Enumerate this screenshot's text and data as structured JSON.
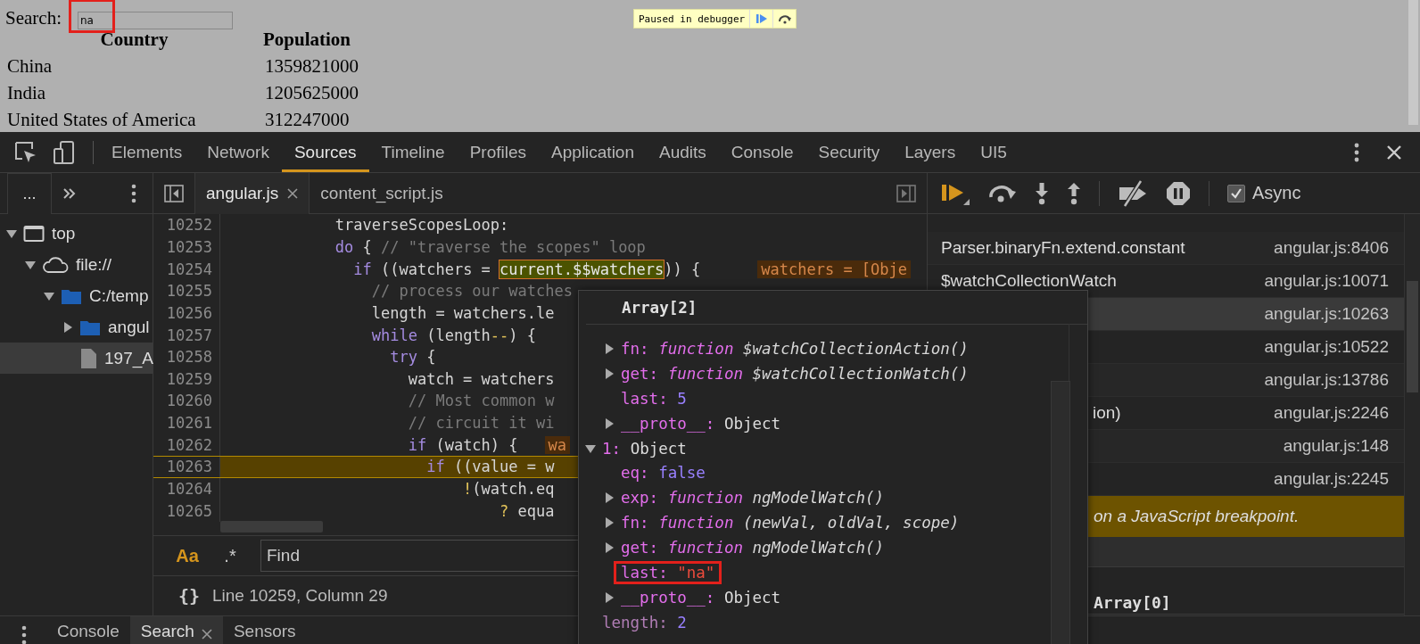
{
  "page": {
    "search_label": "Search:",
    "search_value": "na",
    "search_annotated": true,
    "table": {
      "columns": [
        "Country",
        "Population"
      ],
      "rows": [
        [
          "China",
          "1359821000"
        ],
        [
          "India",
          "1205625000"
        ],
        [
          "United States of America",
          "312247000"
        ]
      ]
    },
    "paused_text": "Paused in debugger"
  },
  "devtools": {
    "tabs": [
      {
        "label": "Elements",
        "selected": false
      },
      {
        "label": "Network",
        "selected": false
      },
      {
        "label": "Sources",
        "selected": true
      },
      {
        "label": "Timeline",
        "selected": false
      },
      {
        "label": "Profiles",
        "selected": false
      },
      {
        "label": "Application",
        "selected": false
      },
      {
        "label": "Audits",
        "selected": false
      },
      {
        "label": "Console",
        "selected": false
      },
      {
        "label": "Security",
        "selected": false
      },
      {
        "label": "Layers",
        "selected": false
      },
      {
        "label": "UI5",
        "selected": false
      }
    ],
    "navigator": {
      "tab_label": "...",
      "tree": [
        {
          "label": "top",
          "kind": "frame",
          "expanded": true,
          "selected": false,
          "children": [
            {
              "label": "file://",
              "kind": "origin",
              "expanded": true,
              "selected": false,
              "children": [
                {
                  "label": "C:/temp",
                  "kind": "folder",
                  "expanded": true,
                  "selected": false,
                  "children": [
                    {
                      "label": "angul",
                      "kind": "folder",
                      "expanded": false,
                      "selected": false
                    },
                    {
                      "label": "197_A",
                      "kind": "file",
                      "selected": true
                    }
                  ]
                }
              ]
            }
          ]
        }
      ]
    },
    "editor": {
      "tabs": [
        {
          "label": "angular.js",
          "selected": true,
          "closable": true
        },
        {
          "label": "content_script.js",
          "selected": false,
          "closable": false
        }
      ],
      "lines": [
        {
          "number": "10252",
          "code": "            traverseScopesLoop:",
          "current": false
        },
        {
          "number": "10253",
          "code": "            do { // \"traverse the scopes\" loop",
          "current": false
        },
        {
          "number": "10254",
          "code": "              if ((watchers = ",
          "evaluated": "current.$$watchers",
          "code_after": ")) {",
          "inline_value": "watchers = [Obje",
          "current": false
        },
        {
          "number": "10255",
          "code": "                // process our watches",
          "current": false
        },
        {
          "number": "10256",
          "code": "                length = watchers.le",
          "current": false
        },
        {
          "number": "10257",
          "code": "                while (length--) {",
          "current": false
        },
        {
          "number": "10258",
          "code": "                  try {",
          "current": false
        },
        {
          "number": "10259",
          "code": "                    watch = watchers",
          "current": false
        },
        {
          "number": "10260",
          "code": "                    // Most common w",
          "current": false
        },
        {
          "number": "10261",
          "code": "                    // circuit it wi",
          "current": false
        },
        {
          "number": "10262",
          "code": "                    if (watch) {",
          "inline_value": "wa",
          "current": false
        },
        {
          "number": "10263",
          "code": "                      if ((value = w",
          "current": true
        },
        {
          "number": "10264",
          "code": "                          !(watch.eq",
          "current": false
        },
        {
          "number": "10265",
          "code": "                              ? equa",
          "current": false
        }
      ],
      "find": {
        "case_label": "Aa",
        "regex_label": ".*",
        "placeholder": "Find"
      },
      "format_label": "{}",
      "status": "Line 10259, Column 29"
    },
    "debugger": {
      "async_label": "Async",
      "async_checked": true,
      "call_stack": [
        {
          "function": "Parser.binaryFn.extend.constant",
          "location": "angular.js:8406",
          "selected": false
        },
        {
          "function": "$watchCollectionWatch",
          "location": "angular.js:10071",
          "selected": false
        },
        {
          "location": "angular.js:10263",
          "selected": true
        },
        {
          "location": "angular.js:10522",
          "selected": false
        },
        {
          "location": "angular.js:13786",
          "selected": false
        },
        {
          "function": "ion)",
          "kind": "partial",
          "location": "angular.js:2246",
          "selected": false
        },
        {
          "location": "angular.js:148",
          "selected": false
        },
        {
          "location": "angular.js:2245",
          "selected": false
        }
      ],
      "paused_message": "on a JavaScript breakpoint.",
      "scope_text": "Array[0]"
    },
    "drawer": {
      "tabs": [
        {
          "label": "Console",
          "selected": false,
          "closable": false
        },
        {
          "label": "Search",
          "selected": true,
          "closable": true
        },
        {
          "label": "Sensors",
          "selected": false,
          "closable": false
        }
      ]
    }
  },
  "popover": {
    "title": "Array[2]",
    "items": [
      {
        "kind": "continuation",
        "children": [
          {
            "kind": "function",
            "key": "fn:",
            "value": "$watchCollectionAction()",
            "expanded": false,
            "enumerable": true,
            "annotated": false
          },
          {
            "kind": "function",
            "key": "get:",
            "value": "$watchCollectionWatch()",
            "expanded": false,
            "enumerable": true,
            "annotated": false
          },
          {
            "kind": "number",
            "key": "last:",
            "value": "5",
            "enumerable": true,
            "annotated": false
          },
          {
            "kind": "object",
            "key": "__proto__:",
            "value": "Object",
            "expanded": false,
            "enumerable": true,
            "annotated": false
          }
        ]
      },
      {
        "kind": "object",
        "key": "1:",
        "value": "Object",
        "expanded": true,
        "enumerable": true,
        "annotated": false,
        "children": [
          {
            "kind": "boolean",
            "key": "eq:",
            "value": "false",
            "enumerable": true,
            "annotated": false
          },
          {
            "kind": "function",
            "key": "exp:",
            "value": "ngModelWatch()",
            "expanded": false,
            "enumerable": true,
            "annotated": false
          },
          {
            "kind": "function",
            "key": "fn:",
            "value": "(newVal, oldVal, scope)",
            "expanded": false,
            "enumerable": true,
            "annotated": false
          },
          {
            "kind": "function",
            "key": "get:",
            "value": "ngModelWatch()",
            "expanded": false,
            "enumerable": true,
            "annotated": false
          },
          {
            "kind": "string",
            "key": "last:",
            "value": "\"na\"",
            "enumerable": true,
            "annotated": true
          },
          {
            "kind": "object",
            "key": "__proto__:",
            "value": "Object",
            "expanded": false,
            "enumerable": true,
            "annotated": false
          }
        ]
      },
      {
        "kind": "number",
        "key": "length:",
        "value": "2",
        "enumerable": false,
        "annotated": false
      }
    ]
  }
}
